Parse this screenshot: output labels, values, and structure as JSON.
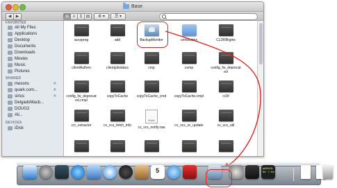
{
  "window": {
    "title": "Base"
  },
  "toolbar": {
    "back_label": "◀",
    "forward_label": "▶",
    "view_icon_label": "⊞",
    "view_list_label": "≡",
    "view_column_label": "⫼",
    "view_cover_label": "▤",
    "action_label": "⚙ ▾",
    "arrange_label": "☰ ▾",
    "search_placeholder": ""
  },
  "sidebar": {
    "favorites_header": "FAVORITES",
    "favorites": [
      {
        "label": "All My Files",
        "icon": "all-files-icon"
      },
      {
        "label": "Applications",
        "icon": "applications-icon"
      },
      {
        "label": "Desktop",
        "icon": "desktop-icon"
      },
      {
        "label": "Documents",
        "icon": "documents-icon"
      },
      {
        "label": "Downloads",
        "icon": "downloads-icon"
      },
      {
        "label": "Movies",
        "icon": "movies-icon"
      },
      {
        "label": "Music",
        "icon": "music-icon"
      },
      {
        "label": "Pictures",
        "icon": "pictures-icon"
      }
    ],
    "shared_header": "SHARED",
    "shared": [
      {
        "label": "mesons",
        "icon": "network-computer-icon",
        "eject": "≙"
      },
      {
        "label": "quark.com...",
        "icon": "network-computer-icon",
        "eject": "≙"
      },
      {
        "label": "sirius",
        "icon": "network-computer-icon",
        "eject": "≙"
      },
      {
        "label": "DelgadoMacb...",
        "icon": "network-computer-icon",
        "eject": ""
      },
      {
        "label": "DOUG2",
        "icon": "network-computer-icon",
        "eject": ""
      },
      {
        "label": "All...",
        "icon": "network-globe-icon",
        "eject": ""
      }
    ],
    "devices_header": "DEVICES",
    "devices": [
      {
        "label": "iDisk",
        "icon": "idisk-icon"
      }
    ]
  },
  "files": [
    {
      "label": "acxxprog",
      "type": "folder"
    },
    {
      "label": "add",
      "type": "folder"
    },
    {
      "label": "BackupMonitor",
      "type": "app"
    },
    {
      "label": "certificates",
      "type": "folder-blue"
    },
    {
      "label": "CLDRBrgins",
      "type": "folder"
    },
    {
      "label": "clientAuthen",
      "type": "folder"
    },
    {
      "label": "clientjobstatus",
      "type": "folder"
    },
    {
      "label": "cmp",
      "type": "folder"
    },
    {
      "label": "comp",
      "type": "folder"
    },
    {
      "label": "config_fw_deprecat\ned",
      "type": "folder"
    },
    {
      "label": "config_fw_deprecat\ned.cmpl",
      "type": "folder"
    },
    {
      "label": "copyToCache",
      "type": "folder"
    },
    {
      "label": "copyToCache_cmd",
      "type": "folder"
    },
    {
      "label": "copyToCache.cmpl",
      "type": "folder"
    },
    {
      "label": "cr2if",
      "type": "folder"
    },
    {
      "label": "crc_extractor",
      "type": "folder"
    },
    {
      "label": "cv_vcs_fetch_info",
      "type": "folder"
    },
    {
      "label": "cv_vcs_notify.raw",
      "type": "raw"
    },
    {
      "label": "cv_vcs_sc_update",
      "type": "folder"
    },
    {
      "label": "cv_vcs_util",
      "type": "folder"
    },
    {
      "label": "",
      "type": "folder"
    },
    {
      "label": "",
      "type": "folder"
    },
    {
      "label": "",
      "type": "folder"
    },
    {
      "label": "",
      "type": "folder"
    },
    {
      "label": "",
      "type": "folder"
    }
  ],
  "dock": {
    "calendar_day": "5",
    "console_text": "WARNIN\nNV 7:04",
    "items": [
      "finder-icon",
      "launchpad-icon",
      "mission-control-icon",
      "app-store-icon",
      "mail-icon",
      "safari-icon",
      "dashboard-icon",
      "address-book-icon",
      "ical-icon",
      "itunes-icon",
      "photo-booth-icon",
      "backup-monitor-icon",
      "system-preferences-icon",
      "terminal-icon",
      "console-icon",
      "document-icon",
      "preview-icon",
      "trash-icon"
    ]
  },
  "colors": {
    "highlight_red": "#d9231f",
    "sidebar_bg": "#e4e9ef",
    "folder_dark": "#3a3a3a",
    "folder_blue": "#6ea3dc"
  }
}
